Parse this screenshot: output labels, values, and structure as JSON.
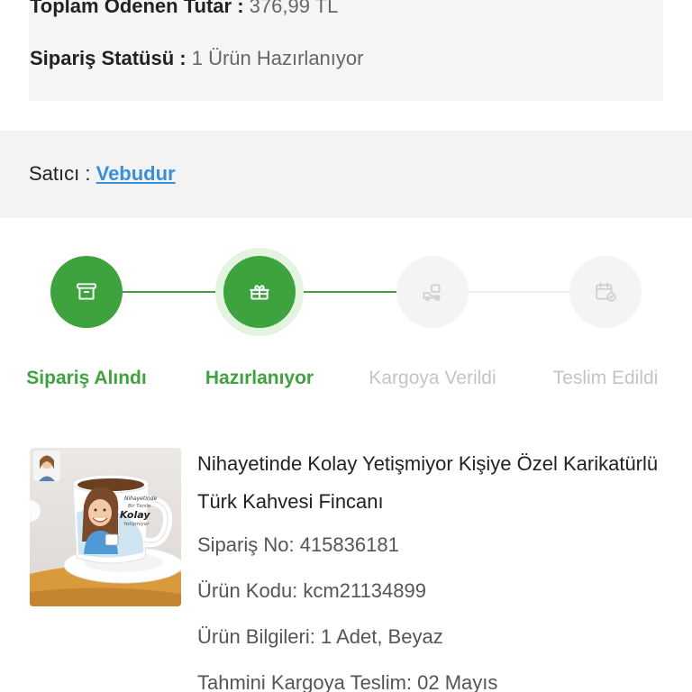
{
  "order_summary": {
    "total_label": "Toplam Ödenen Tutar :",
    "total_value": "376,99 TL",
    "status_label": "Sipariş Statüsü :",
    "status_value": "1 Ürün Hazırlanıyor"
  },
  "seller": {
    "label": "Satıcı :",
    "name": "Vebudur"
  },
  "tracking_steps": [
    {
      "label": "Sipariş Alındı",
      "state": "done",
      "icon": "box-icon"
    },
    {
      "label": "Hazırlanıyor",
      "state": "current",
      "icon": "gift-icon"
    },
    {
      "label": "Kargoya Verildi",
      "state": "pending",
      "icon": "delivery-icon"
    },
    {
      "label": "Teslim Edildi",
      "state": "pending",
      "icon": "calendar-check-icon"
    }
  ],
  "product": {
    "title": "Nihayetinde Kolay Yetişmiyor Kişiye Özel Karikatürlü Türk Kahvesi Fincanı",
    "order_no": "Sipariş No: 415836181",
    "product_code": "Ürün Kodu: kcm21134899",
    "details": "Ürün Bilgileri: 1 Adet, Beyaz",
    "shipping_estimate": "Tahmini Kargoya Teslim: 02 Mayıs",
    "image_text": [
      "Nihayetinde",
      "Bir Tanile",
      "Kolay",
      "Yetişmiyor"
    ]
  },
  "colors": {
    "accent_green": "#3ea33e",
    "link_blue": "#3b8fd9",
    "inactive_gray": "#c4c4c4"
  }
}
